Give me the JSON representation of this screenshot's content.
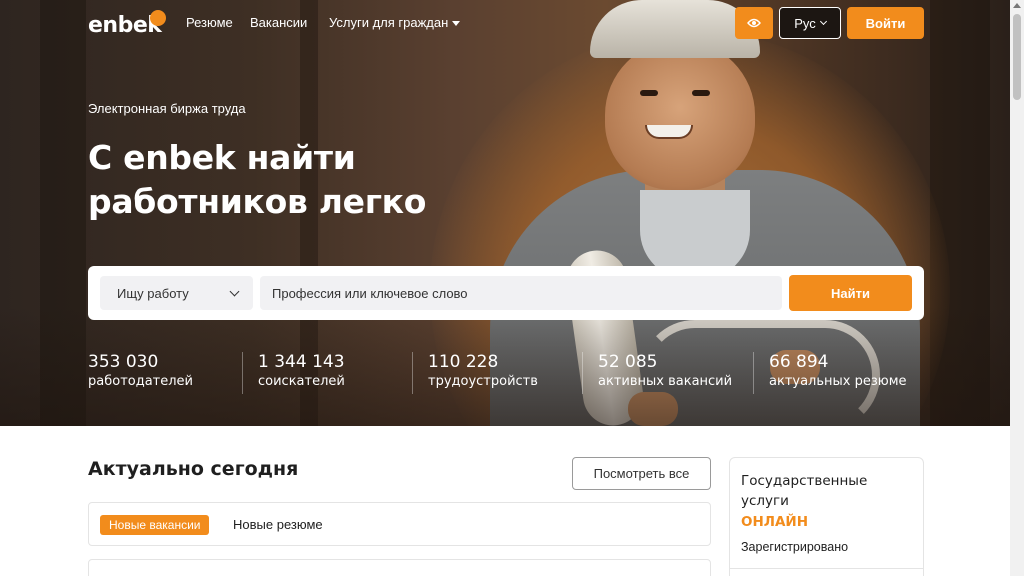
{
  "header": {
    "logo": "enbek",
    "nav": [
      {
        "label": "Резюме"
      },
      {
        "label": "Вакансии"
      },
      {
        "label": "Услуги для граждан"
      }
    ],
    "language": "Рус",
    "login_label": "Войти"
  },
  "hero": {
    "subtitle": "Электронная биржа труда",
    "title_line1": "С enbek найти",
    "title_line2": "работников легко"
  },
  "search": {
    "mode": "Ищу работу",
    "placeholder": "Профессия или ключевое слово",
    "button": "Найти"
  },
  "stats": [
    {
      "value": "353 030",
      "label": "работодателей"
    },
    {
      "value": "1 344 143",
      "label": "соискателей"
    },
    {
      "value": "110 228",
      "label": "трудоустройств"
    },
    {
      "value": "52 085",
      "label": "активных вакансий"
    },
    {
      "value": "66 894",
      "label": "актуальных резюме"
    }
  ],
  "today": {
    "title": "Актуально сегодня",
    "view_all": "Посмотреть все",
    "tabs": [
      {
        "label": "Новые вакансии",
        "active": true
      },
      {
        "label": "Новые резюме",
        "active": false
      }
    ]
  },
  "gov_services": {
    "title": "Государственные услуги",
    "online": "ОНЛАЙН",
    "registered": "Зарегистрировано"
  },
  "colors": {
    "accent": "#f28c1c",
    "text": "#1f1f1f",
    "hero_overlay": "#3e2f24"
  },
  "icons": [
    "eye-icon",
    "chevron-down-icon",
    "caret-down-icon"
  ]
}
